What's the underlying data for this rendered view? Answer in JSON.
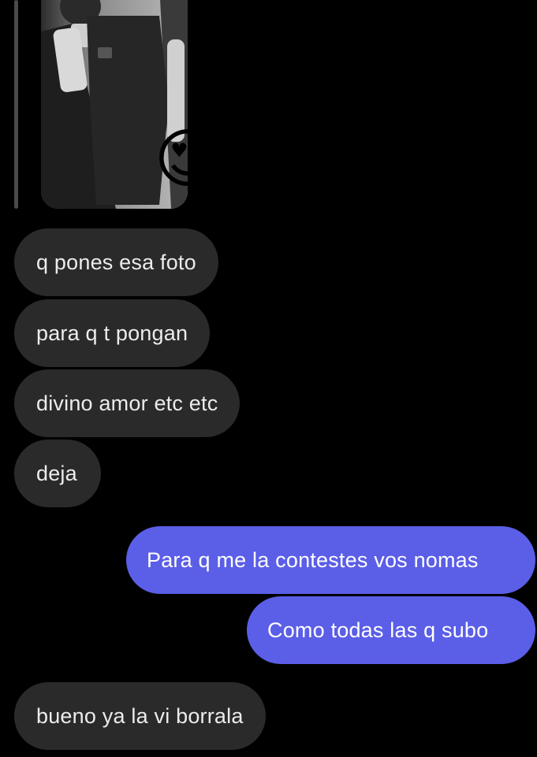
{
  "colors": {
    "background": "#000000",
    "incoming_bubble": "#2a2a2a",
    "outgoing_bubble": "#5b5ee6"
  },
  "story_reply": {
    "reaction_emoji": "😍",
    "reaction_icon": "heart-eyes-emoji-icon"
  },
  "messages": [
    {
      "direction": "incoming",
      "text": "q pones esa foto"
    },
    {
      "direction": "incoming",
      "text": "para q t pongan"
    },
    {
      "direction": "incoming",
      "text": "divino amor etc etc"
    },
    {
      "direction": "incoming",
      "text": "deja"
    },
    {
      "direction": "outgoing",
      "text": "Para q me la contestes vos nomas"
    },
    {
      "direction": "outgoing",
      "text": "Como todas las q subo"
    },
    {
      "direction": "incoming",
      "text": "bueno ya la vi borrala"
    }
  ]
}
